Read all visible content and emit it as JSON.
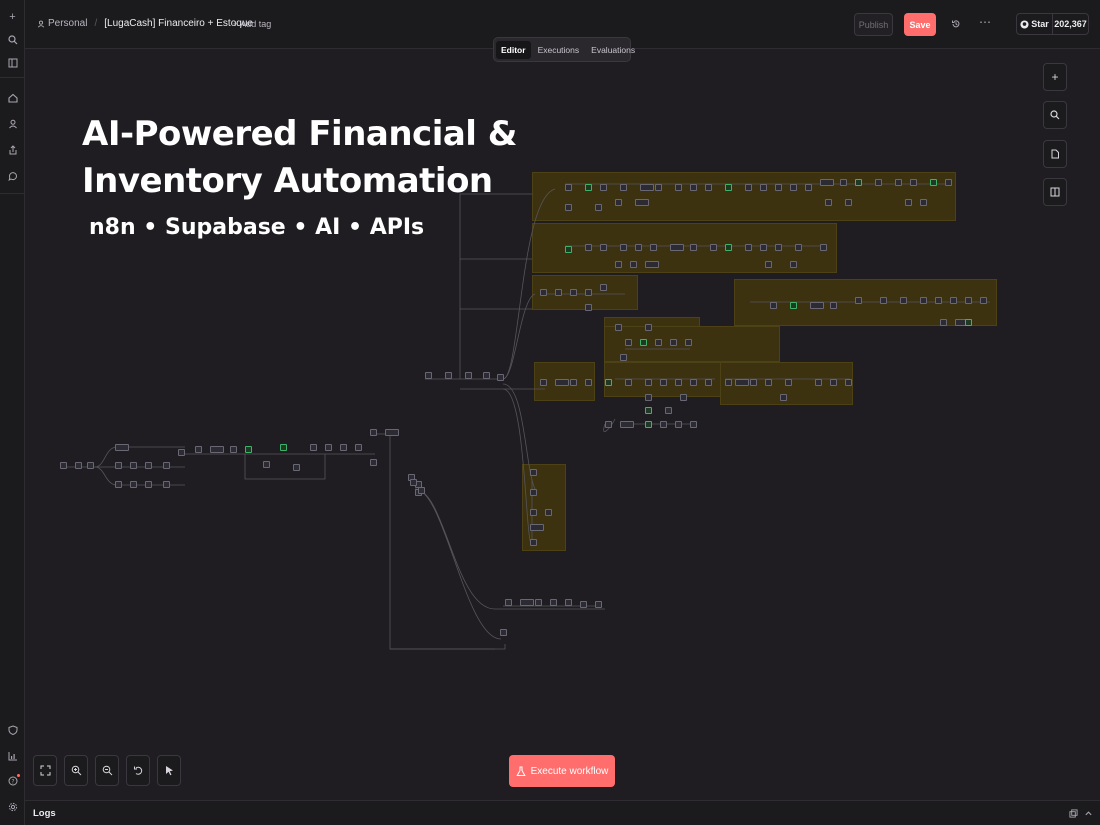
{
  "rail": {
    "top_icons": [
      "plus-icon",
      "search-icon",
      "sidebar-toggle-icon"
    ],
    "nav_icons": [
      "home-icon",
      "user-icon",
      "share-icon",
      "chat-icon"
    ],
    "bottom_icons": [
      "shield-icon",
      "chart-icon",
      "help-icon",
      "settings-icon"
    ]
  },
  "header": {
    "project": "Personal",
    "workflow_name": "[LugaCash] Financeiro + Estoque",
    "add_tag": "+ Add tag",
    "publish_label": "Publish",
    "save_label": "Save",
    "github_star_label": "Star",
    "github_stars": "202,367"
  },
  "tabs": [
    {
      "label": "Editor",
      "active": true
    },
    {
      "label": "Executions",
      "active": false
    },
    {
      "label": "Evaluations",
      "active": false
    }
  ],
  "canvas": {
    "title_line1": "AI-Powered Financial &",
    "title_line2": "Inventory Automation",
    "subtitle": "n8n • Supabase • AI • APIs"
  },
  "right_tools": [
    "add-node-icon",
    "search-nodes-icon",
    "sticky-note-icon",
    "panel-icon"
  ],
  "bottom_tools": [
    "fit-view-icon",
    "zoom-in-icon",
    "zoom-out-icon",
    "undo-icon",
    "pointer-icon"
  ],
  "execute_label": "Execute workflow",
  "logs": {
    "label": "Logs"
  },
  "colors": {
    "accent": "#ff6d6d",
    "sticky": "#3c3210",
    "background": "#1f1d21"
  }
}
